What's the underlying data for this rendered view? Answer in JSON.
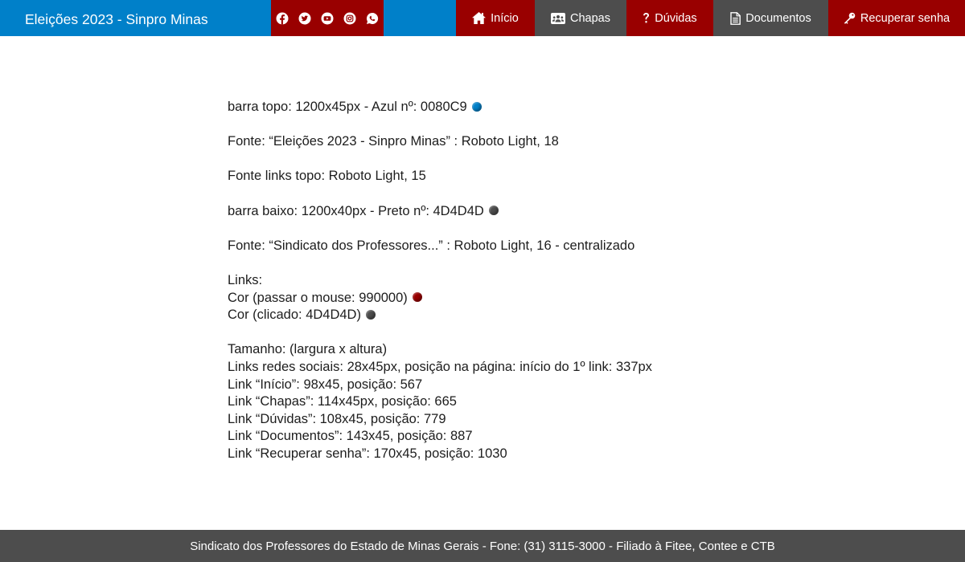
{
  "header": {
    "title": "Eleições 2023 - Sinpro Minas",
    "bar_color": "#0080C9",
    "social": [
      {
        "icon": "facebook-icon"
      },
      {
        "icon": "twitter-icon"
      },
      {
        "icon": "youtube-icon"
      },
      {
        "icon": "instagram-icon"
      },
      {
        "icon": "whatsapp-icon"
      }
    ],
    "nav": {
      "inicio": {
        "label": "Início",
        "icon": "home-icon"
      },
      "chapas": {
        "label": "Chapas",
        "icon": "users-icon"
      },
      "duvidas": {
        "label": "Dúvidas",
        "icon": "question-icon"
      },
      "documentos": {
        "label": "Documentos",
        "icon": "document-icon"
      },
      "recuperar": {
        "label": "Recuperar senha",
        "icon": "key-icon"
      }
    }
  },
  "content": {
    "lines": [
      "barra topo: 1200x45px - Azul nº: 0080C9",
      "Fonte: “Eleições 2023 - Sinpro Minas” : Roboto Light, 18",
      "Fonte links topo: Roboto Light, 15",
      "barra baixo: 1200x40px - Preto nº: 4D4D4D",
      "Fonte: “Sindicato dos Professores...” : Roboto Light, 16 - centralizado",
      "Links:",
      "Cor (passar o mouse: 990000)",
      "Cor (clicado: 4D4D4D)",
      "Tamanho: (largura x altura)",
      "Links redes sociais: 28x45px, posição na página: início do 1º link: 337px",
      "Link “Início”: 98x45, posição: 567",
      "Link “Chapas”: 114x45px, posição: 665",
      "Link “Dúvidas”: 108x45, posição: 779",
      "Link “Documentos”: 143x45, posição: 887",
      "Link “Recuperar senha”: 170x45, posição: 1030"
    ],
    "swatch_colors": {
      "blue": "#0080C9",
      "gray": "#4D4D4D",
      "red": "#990000"
    }
  },
  "footer": {
    "text": "Sindicato dos Professores do Estado de Minas Gerais - Fone: (31) 3115-3000  - Filiado à Fitee, Contee e CTB",
    "bar_color": "#4D4D4D"
  }
}
